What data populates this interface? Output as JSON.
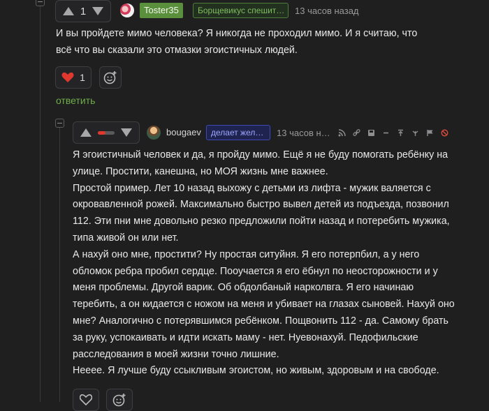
{
  "comment1": {
    "vote_count": "1",
    "username": "Toster35",
    "status": "Борщевикус спешит…",
    "time": "13 часов назад",
    "text": "И вы пройдете мимо человека? Я никогда не проходил мимо. И я считаю, что всё что вы сказали это отмазки эгоистичных людей.",
    "like_count": "1",
    "reply_label": "ответить"
  },
  "comment2": {
    "username": "bougaev",
    "status": "делает жел…",
    "time": "13 часов н…",
    "rating_fraction": 0.45,
    "paragraphs": [
      "Я эгоистичный человек и да, я пройду мимо. Ещё я не буду помогать ребёнку на улице. Простити, канешна, но МОЯ жизнь мне важнее.",
      "Простой пример. Лет 10 назад выхожу с детьми из лифта - мужик валяется с окровавленной рожей. Максимально быстро вывел детей из подъезда, позвонил 112. Эти пни мне довольно резко предложили пойти назад и потеребить мужика, типа живой он или нет.",
      "А нахуй оно мне, простити? Ну простая ситуйня. Я его потерпбил, а у него обломок ребра пробил сердце. Пооучается я его ёбнул по неосторожности и у меня проблемы. Другой варик. Об обдолбаный нарколвга. Я его начинаю теребить, а он кидается с ножом на меня и убивает на глазах сыновей. Нахуй оно мне? Аналогично с потерявшимся ребёнком. Пощвонить 112 - да. Самому брать за руку, успокаивать и идти искать маму - нет. Нуевонахуй. Педофильские расследования в моей жизни точно лишние.",
      "Нееее. Я лучше буду ссыкливым эгоистом, но живым, здоровым и на свободе."
    ]
  },
  "colors": {
    "background": "#1f1f20",
    "accent_green": "#6fae4a",
    "like_red": "#e0382e",
    "status_blue": "#3d49b8"
  }
}
